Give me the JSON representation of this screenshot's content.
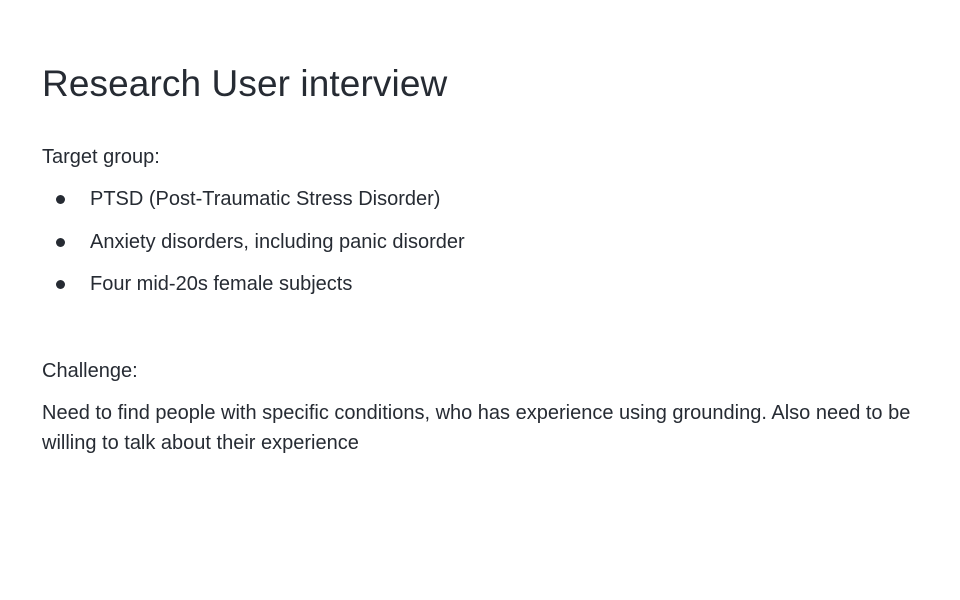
{
  "slide": {
    "title": "Research User interview",
    "target_group": {
      "label": "Target group:",
      "items": [
        "PTSD (Post-Traumatic Stress Disorder)",
        "Anxiety disorders, including panic disorder",
        "Four mid-20s female subjects"
      ]
    },
    "challenge": {
      "label": "Challenge:",
      "text": "Need to find people with specific conditions, who has experience using grounding. Also need to be willing to talk about their experience"
    }
  },
  "colors": {
    "text": "#262b33",
    "background": "#ffffff"
  }
}
